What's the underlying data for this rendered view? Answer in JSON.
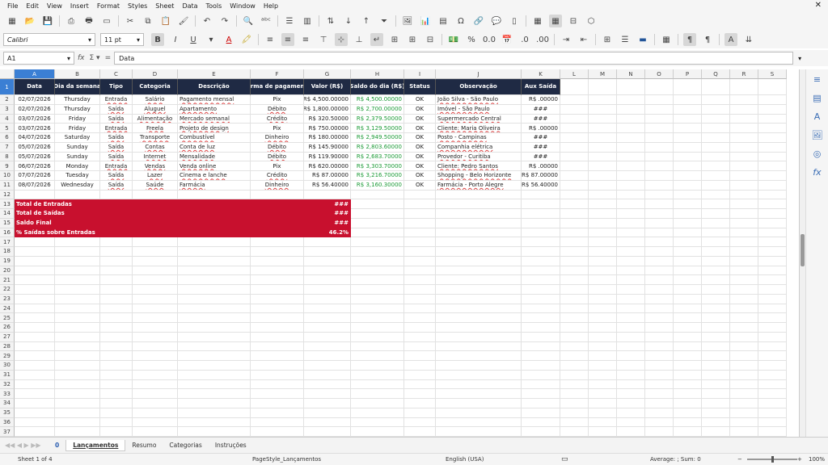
{
  "menu": [
    "File",
    "Edit",
    "View",
    "Insert",
    "Format",
    "Styles",
    "Sheet",
    "Data",
    "Tools",
    "Window",
    "Help"
  ],
  "font_name": "Calibri",
  "font_size": "11 pt",
  "formula": {
    "cell_ref": "A1",
    "content": "Data"
  },
  "columns": [
    "A",
    "B",
    "C",
    "D",
    "E",
    "F",
    "G",
    "H",
    "I",
    "J",
    "K",
    "L",
    "M",
    "N",
    "O",
    "P",
    "Q",
    "R",
    "S"
  ],
  "headers": [
    "Data",
    "Dia da semana",
    "Tipo",
    "Categoria",
    "Descrição",
    "Forma de pagamento",
    "Valor (R$)",
    "Saldo do dia (R$)",
    "Status",
    "Observação",
    "Aux Saída"
  ],
  "rows": [
    [
      "02/07/2026",
      "Thursday",
      "Entrada",
      "Salário",
      "Pagamento mensal",
      "Pix",
      "R$ 4,500.00000",
      "R$ 4,500.00000",
      "OK",
      "João Silva - São Paulo",
      "R$ .00000"
    ],
    [
      "02/07/2026",
      "Thursday",
      "Saída",
      "Aluguel",
      "Apartamento",
      "Débito",
      "R$ 1,800.00000",
      "R$ 2,700.00000",
      "OK",
      "Imóvel - São Paulo",
      "###"
    ],
    [
      "03/07/2026",
      "Friday",
      "Saída",
      "Alimentação",
      "Mercado semanal",
      "Crédito",
      "R$ 320.50000",
      "R$ 2,379.50000",
      "OK",
      "Supermercado Central",
      "###"
    ],
    [
      "03/07/2026",
      "Friday",
      "Entrada",
      "Freela",
      "Projeto de design",
      "Pix",
      "R$ 750.00000",
      "R$ 3,129.50000",
      "OK",
      "Cliente: Maria Oliveira",
      "R$ .00000"
    ],
    [
      "04/07/2026",
      "Saturday",
      "Saída",
      "Transporte",
      "Combustível",
      "Dinheiro",
      "R$ 180.00000",
      "R$ 2,949.50000",
      "OK",
      "Posto - Campinas",
      "###"
    ],
    [
      "05/07/2026",
      "Sunday",
      "Saída",
      "Contas",
      "Conta de luz",
      "Débito",
      "R$ 145.90000",
      "R$ 2,803.60000",
      "OK",
      "Companhia elétrica",
      "###"
    ],
    [
      "05/07/2026",
      "Sunday",
      "Saída",
      "Internet",
      "Mensalidade",
      "Débito",
      "R$ 119.90000",
      "R$ 2,683.70000",
      "OK",
      "Provedor - Curitiba",
      "###"
    ],
    [
      "06/07/2026",
      "Monday",
      "Entrada",
      "Vendas",
      "Venda online",
      "Pix",
      "R$ 620.00000",
      "R$ 3,303.70000",
      "OK",
      "Cliente: Pedro Santos",
      "R$ .00000"
    ],
    [
      "07/07/2026",
      "Tuesday",
      "Saída",
      "Lazer",
      "Cinema e lanche",
      "Crédito",
      "R$ 87.00000",
      "R$ 3,216.70000",
      "OK",
      "Shopping - Belo Horizonte",
      "R$ 87.00000"
    ],
    [
      "08/07/2026",
      "Wednesday",
      "Saída",
      "Saúde",
      "Farmácia",
      "Dinheiro",
      "R$ 56.40000",
      "R$ 3,160.30000",
      "OK",
      "Farmácia - Porto Alegre",
      "R$ 56.40000"
    ]
  ],
  "summary": [
    {
      "label": "Total de Entradas",
      "value": "###"
    },
    {
      "label": "Total de Saídas",
      "value": "###"
    },
    {
      "label": "Saldo Final",
      "value": "###"
    },
    {
      "label": "% Saídas sobre Entradas",
      "value": "46.2%"
    }
  ],
  "tabs": [
    "Lançamentos",
    "Resumo",
    "Categorias",
    "Instruções"
  ],
  "tab_counter": "0",
  "status": {
    "sheet": "Sheet 1 of 4",
    "page_style": "PageStyle_Lançamentos",
    "language": "English (USA)",
    "stats": "Average: ; Sum: 0",
    "zoom": "100%"
  }
}
